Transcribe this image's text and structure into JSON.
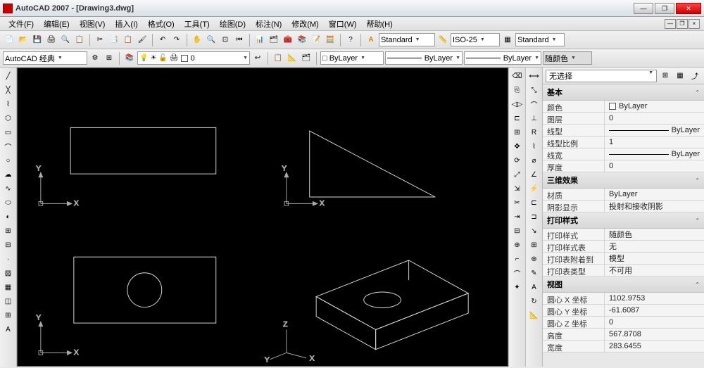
{
  "window": {
    "title": "AutoCAD 2007 - [Drawing3.dwg]",
    "minimize": "—",
    "maximize": "❐",
    "close": "✕"
  },
  "menu": {
    "items": [
      "文件(F)",
      "编辑(E)",
      "视图(V)",
      "插入(I)",
      "格式(O)",
      "工具(T)",
      "绘图(D)",
      "标注(N)",
      "修改(M)",
      "窗口(W)",
      "帮助(H)"
    ]
  },
  "toolbar1": {
    "styles": {
      "text": "Standard",
      "dim": "ISO-25",
      "table": "Standard"
    },
    "styleIcon": "A"
  },
  "toolbar2": {
    "workspace": "AutoCAD 经典",
    "layer": "0",
    "color": "□ ByLayer",
    "linetype": "ByLayer",
    "lineweight": "ByLayer",
    "plotstyle": "随颜色"
  },
  "props": {
    "selection": "无选择",
    "sections": {
      "basic": {
        "title": "基本",
        "rows": [
          {
            "label": "颜色",
            "value": "ByLayer",
            "swatch": true
          },
          {
            "label": "图层",
            "value": "0"
          },
          {
            "label": "线型",
            "value": "ByLayer",
            "line": true
          },
          {
            "label": "线型比例",
            "value": "1"
          },
          {
            "label": "线宽",
            "value": "ByLayer",
            "line": true
          },
          {
            "label": "厚度",
            "value": "0"
          }
        ]
      },
      "threed": {
        "title": "三维效果",
        "rows": [
          {
            "label": "材质",
            "value": "ByLayer"
          },
          {
            "label": "阴影显示",
            "value": "投射和接收阴影"
          }
        ]
      },
      "plot": {
        "title": "打印样式",
        "rows": [
          {
            "label": "打印样式",
            "value": "随颜色"
          },
          {
            "label": "打印样式表",
            "value": "无"
          },
          {
            "label": "打印表附着到",
            "value": "模型"
          },
          {
            "label": "打印表类型",
            "value": "不可用"
          }
        ]
      },
      "view": {
        "title": "视图",
        "rows": [
          {
            "label": "圆心 X 坐标",
            "value": "1102.9753"
          },
          {
            "label": "圆心 Y 坐标",
            "value": "-61.6087"
          },
          {
            "label": "圆心 Z 坐标",
            "value": "0"
          },
          {
            "label": "高度",
            "value": "567.8708"
          },
          {
            "label": "宽度",
            "value": "283.6455"
          }
        ]
      }
    }
  }
}
